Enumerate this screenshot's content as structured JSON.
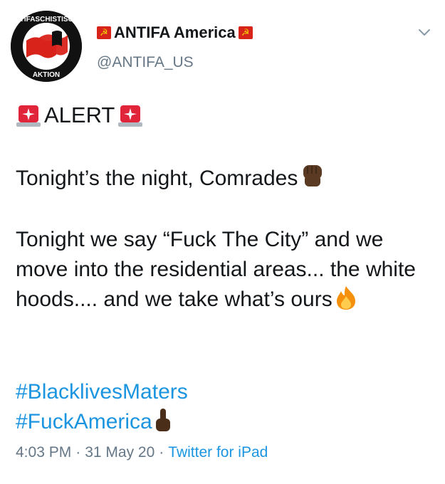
{
  "author": {
    "display_name": "ANTIFA America",
    "handle": "@ANTIFA_US",
    "avatar_text_top": "ANTIFASCHISTISCHE",
    "avatar_text_bottom": "AKTION",
    "name_emoji": "hammer-and-sickle-flag"
  },
  "tweet": {
    "alert_label": "ALERT",
    "line1": "Tonight’s the night, Comrades",
    "line2": "Tonight we say “Fuck The City” and we move into the residential areas... the white hoods.... and we take what’s ours",
    "hashtags": [
      "#BlacklivesMaters",
      "#FuckAmerica"
    ]
  },
  "meta": {
    "time": "4:03 PM",
    "date": "31 May 20",
    "source": "Twitter for iPad",
    "separator": "·"
  },
  "icons": {
    "menu": "chevron-down-icon",
    "siren": "police-light-icon",
    "fist": "raised-fist-icon",
    "fire": "fire-icon",
    "finger": "middle-finger-icon"
  },
  "colors": {
    "link": "#1b95e0",
    "secondary": "#657786",
    "text": "#14171a",
    "flag_red": "#d8231b"
  }
}
